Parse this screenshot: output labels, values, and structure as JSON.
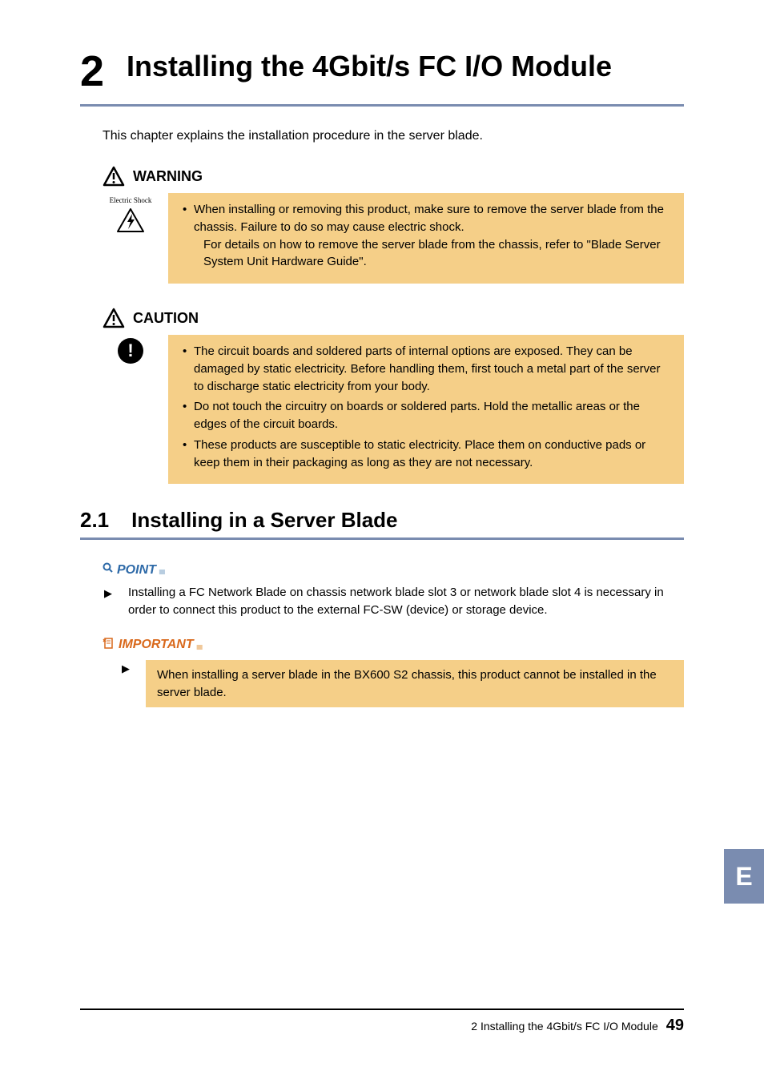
{
  "chapter": {
    "number": "2",
    "title": "Installing the 4Gbit/s FC I/O Module"
  },
  "intro": "This chapter explains the installation procedure in the server blade.",
  "warning": {
    "label": "WARNING",
    "side_label": "Electric Shock",
    "items": [
      "When installing or removing this product, make sure to remove the server blade from the chassis. Failure to do so may cause electric shock."
    ],
    "continued": "For details on how to remove the server blade from the chassis, refer to \"Blade Server System Unit Hardware Guide\"."
  },
  "caution": {
    "label": "CAUTION",
    "items": [
      "The circuit boards and soldered parts of internal options are exposed. They can be damaged by static electricity. Before handling them, first touch a metal part of the server to discharge static electricity from your body.",
      "Do not touch the circuitry on boards or soldered parts. Hold the metallic areas or the edges of the circuit boards.",
      "These products are susceptible to static electricity. Place them on conductive pads or keep them in their packaging as long as they are not necessary."
    ]
  },
  "section": {
    "number": "2.1",
    "title": "Installing in a Server Blade"
  },
  "point": {
    "label": "POINT",
    "text": "Installing a FC Network Blade on chassis network blade slot 3 or network blade slot 4 is necessary in order to connect this product to the external FC-SW (device) or storage device."
  },
  "important": {
    "label": "IMPORTANT",
    "text": "When installing a server blade in the BX600 S2 chassis, this product cannot be installed in the server blade."
  },
  "side_tab": "E",
  "footer": {
    "text": "2  Installing the 4Gbit/s FC I/O Module",
    "page": "49"
  }
}
